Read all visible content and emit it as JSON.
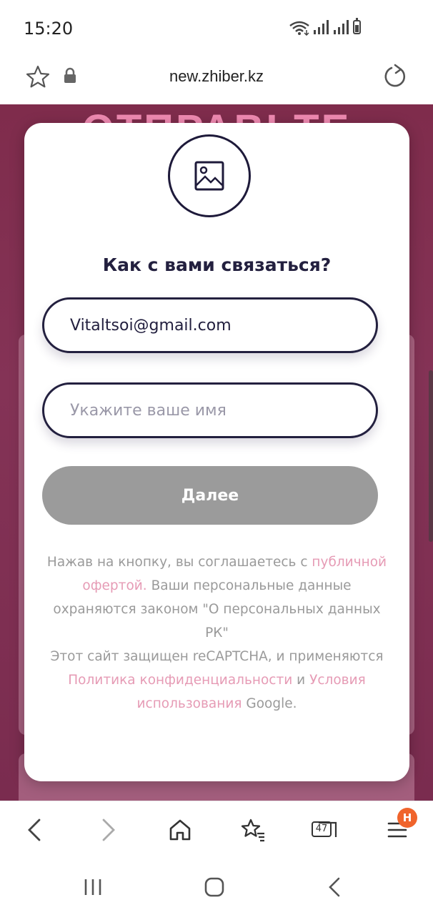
{
  "status_bar": {
    "time": "15:20"
  },
  "browser": {
    "url": "new.zhiber.kz",
    "tabs_count": "47",
    "menu_badge": "H"
  },
  "background": {
    "heading": "ОТПРАВЬТЕ"
  },
  "modal": {
    "title": "Как с вами связаться?",
    "email_value": "Vitaltsoi@gmail.com",
    "name_placeholder": "Укажите ваше имя",
    "next_button": "Далее",
    "disclaimer": {
      "part1": "Нажав на кнопку, вы соглашаетесь с",
      "offer_link": "публичной офертой.",
      "part2": "Ваши персональные данные охраняются законом \"О персональных данных РК\"",
      "part3": "Этот сайт защищен reCAPTCHA, и применяются",
      "privacy_link": "Политика конфиденциальности",
      "and": "и",
      "terms_link": "Условия использования",
      "part4": "Google."
    }
  },
  "colors": {
    "accent_dark": "#23203f",
    "link_pink": "#e69bb5",
    "button_disabled": "#9b9b9b",
    "page_bg": "#7f2c4c",
    "badge": "#f0642c"
  },
  "icons": [
    "star-icon",
    "lock-icon",
    "reload-icon",
    "image-icon",
    "back-icon",
    "forward-icon",
    "home-icon",
    "bookmarks-icon",
    "tabs-icon",
    "menu-icon"
  ]
}
